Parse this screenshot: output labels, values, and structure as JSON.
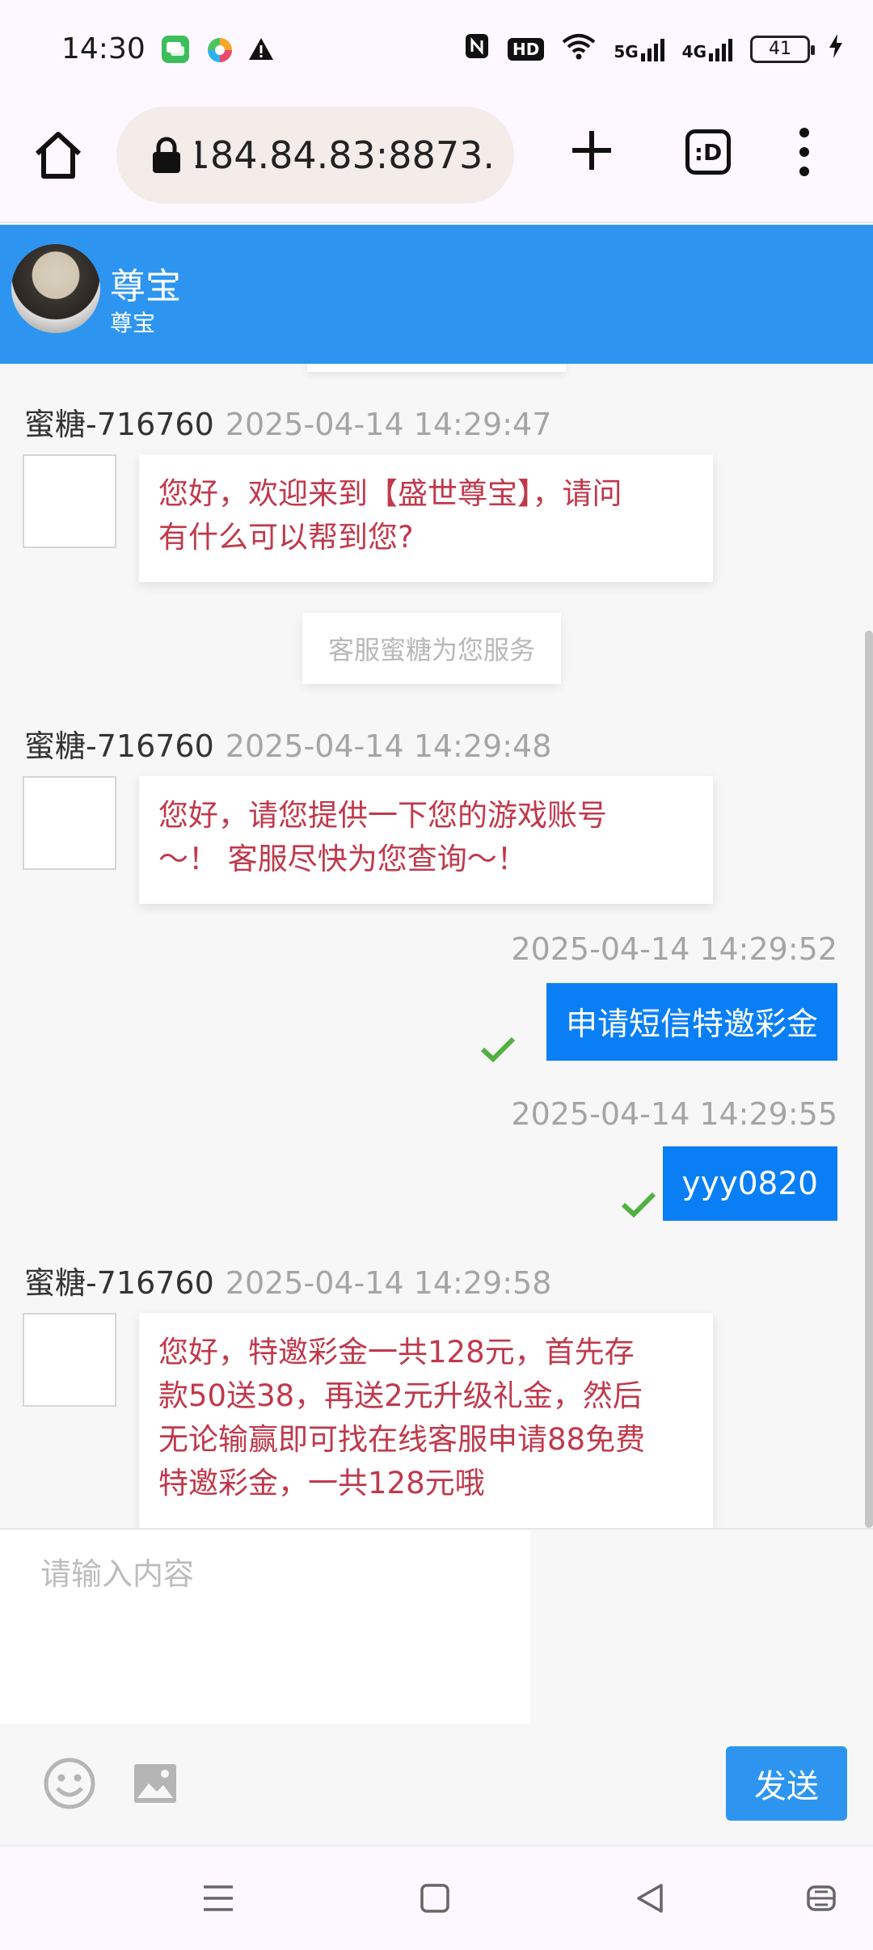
{
  "status_bar": {
    "time": "14:30",
    "battery": "41",
    "signal_5g": "5G",
    "signal_4g": "4G",
    "hd": "HD",
    "icons": [
      "messages-app-icon",
      "pinwheel-app-icon",
      "warning-icon",
      "nfc-icon",
      "hd-icon",
      "wifi-icon",
      "signal-icon",
      "battery-icon",
      "charging-icon"
    ]
  },
  "browser": {
    "url": ".184.84.83:8873",
    "tabs_label": ":D"
  },
  "chat_header": {
    "name": "尊宝",
    "subtitle": "尊宝"
  },
  "messages": [
    {
      "type": "agent",
      "sender": "蜜糖-716760",
      "timestamp": "2025-04-14 14:29:47",
      "lines": [
        "您好，欢迎来到【盛世尊宝】，请问",
        "有什么可以帮到您?"
      ]
    },
    {
      "type": "system",
      "text": "客服蜜糖为您服务"
    },
    {
      "type": "agent",
      "sender": "蜜糖-716760",
      "timestamp": "2025-04-14 14:29:48",
      "lines": [
        "您好，请您提供一下您的游戏账号",
        "～！ 客服尽快为您查询～！"
      ]
    },
    {
      "type": "user",
      "timestamp": "2025-04-14 14:29:52",
      "text": "申请短信特邀彩金"
    },
    {
      "type": "user",
      "timestamp": "2025-04-14 14:29:55",
      "text": "yyy0820"
    },
    {
      "type": "agent",
      "sender": "蜜糖-716760",
      "timestamp": "2025-04-14 14:29:58",
      "lines": [
        "您好，特邀彩金一共128元，首先存",
        "款50送38，再送2元升级礼金，然后",
        "无论输赢即可找在线客服申请88免费",
        "特邀彩金，一共128元哦"
      ]
    }
  ],
  "input": {
    "placeholder": "请输入内容",
    "send_label": "发送"
  },
  "colors": {
    "header_blue": "#2d95f0",
    "user_bubble": "#0a7ff5",
    "agent_text": "#c0394b",
    "check_green": "#52b043"
  }
}
